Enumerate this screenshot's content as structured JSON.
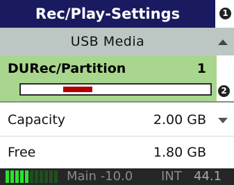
{
  "header": {
    "title": "Rec/Play-Settings",
    "badge": "1"
  },
  "source": {
    "label": "USB Media",
    "arrow_icon": "up-arrow-icon"
  },
  "partition": {
    "label": "DURec/Partition",
    "value": "1",
    "badge": "2",
    "slider_marker_fraction": 0.3
  },
  "rows": [
    {
      "label": "Capacity",
      "value": "2.00 GB",
      "arrow_icon": "down-arrow-icon"
    },
    {
      "label": "Free",
      "value": "1.80 GB"
    }
  ],
  "status": {
    "main_label": "Main -10.0",
    "input_label": "INT",
    "sample_rate": "44.1"
  },
  "colors": {
    "title_bg": "#1a1a60",
    "usb_bg": "#bcc7c4",
    "partition_bg": "#a9d68e",
    "slider_marker": "#b00000",
    "status_bg": "#262626",
    "meter_green": "#2ee02e"
  }
}
